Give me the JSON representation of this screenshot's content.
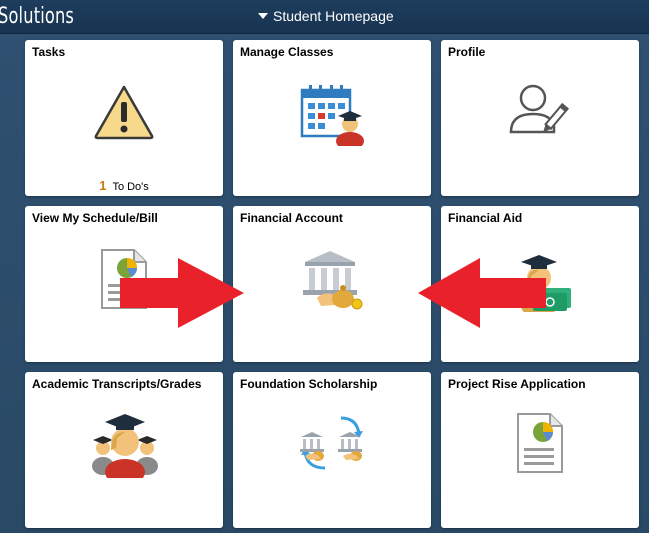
{
  "header": {
    "brand": "Solutions",
    "page_menu_label": "Student Homepage"
  },
  "tiles": [
    {
      "title": "Tasks",
      "icon": "warning-icon",
      "badge_count": "1",
      "badge_label": "To Do's"
    },
    {
      "title": "Manage Classes",
      "icon": "calendar-student-icon"
    },
    {
      "title": "Profile",
      "icon": "user-edit-icon"
    },
    {
      "title": "View My Schedule/Bill",
      "icon": "document-chart-icon"
    },
    {
      "title": "Financial Account",
      "icon": "bank-money-icon"
    },
    {
      "title": "Financial Aid",
      "icon": "graduate-money-icon"
    },
    {
      "title": "Academic Transcripts/Grades",
      "icon": "graduates-icon"
    },
    {
      "title": "Foundation Scholarship",
      "icon": "bank-exchange-icon"
    },
    {
      "title": "Project Rise Application",
      "icon": "document-chart-icon"
    }
  ],
  "colors": {
    "background": "#2c4a6b",
    "header": "#1e3c5c",
    "tile": "#ffffff",
    "annotation_arrow": "#e8212a",
    "badge_count": "#c77a12"
  }
}
